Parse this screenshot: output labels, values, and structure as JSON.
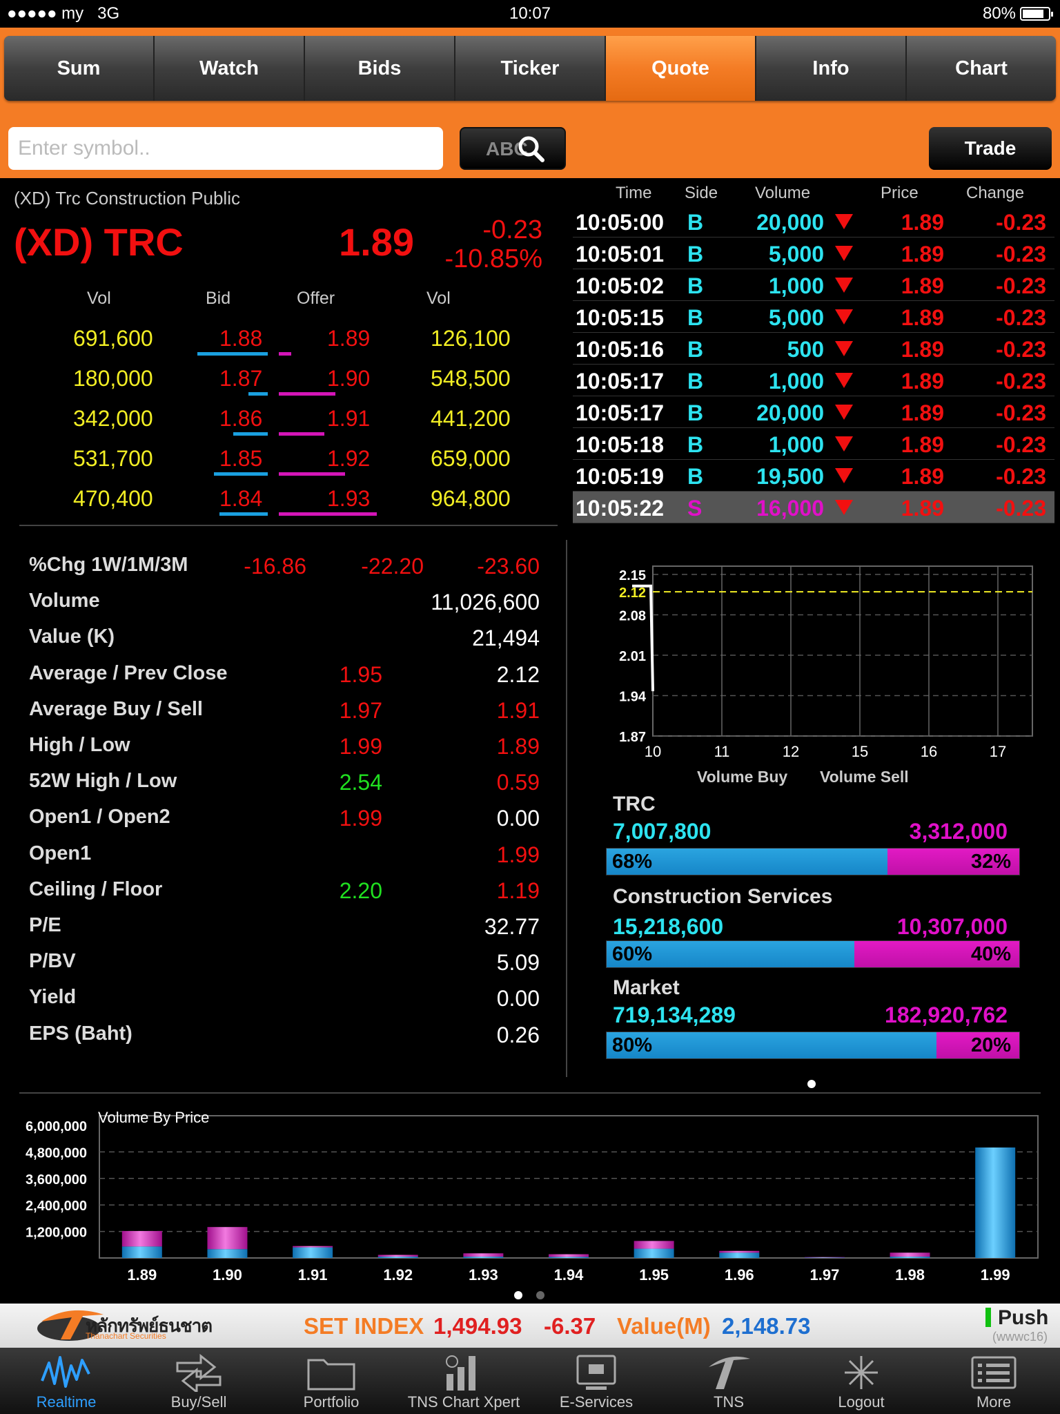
{
  "status": {
    "carrier": "●●●●● my",
    "network": "3G",
    "time": "10:07",
    "battery": "80%"
  },
  "tabs": [
    "Sum",
    "Watch",
    "Bids",
    "Ticker",
    "Quote",
    "Info",
    "Chart"
  ],
  "active_tab": "Quote",
  "search": {
    "placeholder": "Enter symbol..",
    "abc_label": "ABC"
  },
  "trade_label": "Trade",
  "stock": {
    "company": "(XD) Trc Construction Public",
    "symbol": "(XD) TRC",
    "last": "1.89",
    "change": "-0.23",
    "pct": "-10.85%"
  },
  "bidoffer": {
    "headers": [
      "Vol",
      "Bid",
      "Offer",
      "Vol"
    ],
    "rows": [
      {
        "bid_vol": "691,600",
        "bid": "1.88",
        "offer": "1.89",
        "offer_vol": "126,100"
      },
      {
        "bid_vol": "180,000",
        "bid": "1.87",
        "offer": "1.90",
        "offer_vol": "548,500"
      },
      {
        "bid_vol": "342,000",
        "bid": "1.86",
        "offer": "1.91",
        "offer_vol": "441,200"
      },
      {
        "bid_vol": "531,700",
        "bid": "1.85",
        "offer": "1.92",
        "offer_vol": "659,000"
      },
      {
        "bid_vol": "470,400",
        "bid": "1.84",
        "offer": "1.93",
        "offer_vol": "964,800"
      }
    ]
  },
  "ticker": {
    "headers": [
      "Time",
      "Side",
      "Volume",
      "Price",
      "Change"
    ],
    "rows": [
      {
        "time": "10:05:00",
        "side": "B",
        "volume": "20,000",
        "price": "1.89",
        "change": "-0.23"
      },
      {
        "time": "10:05:01",
        "side": "B",
        "volume": "5,000",
        "price": "1.89",
        "change": "-0.23"
      },
      {
        "time": "10:05:02",
        "side": "B",
        "volume": "1,000",
        "price": "1.89",
        "change": "-0.23"
      },
      {
        "time": "10:05:15",
        "side": "B",
        "volume": "5,000",
        "price": "1.89",
        "change": "-0.23"
      },
      {
        "time": "10:05:16",
        "side": "B",
        "volume": "500",
        "price": "1.89",
        "change": "-0.23"
      },
      {
        "time": "10:05:17",
        "side": "B",
        "volume": "1,000",
        "price": "1.89",
        "change": "-0.23"
      },
      {
        "time": "10:05:17",
        "side": "B",
        "volume": "20,000",
        "price": "1.89",
        "change": "-0.23"
      },
      {
        "time": "10:05:18",
        "side": "B",
        "volume": "1,000",
        "price": "1.89",
        "change": "-0.23"
      },
      {
        "time": "10:05:19",
        "side": "B",
        "volume": "19,500",
        "price": "1.89",
        "change": "-0.23"
      },
      {
        "time": "10:05:22",
        "side": "S",
        "volume": "16,000",
        "price": "1.89",
        "change": "-0.23"
      }
    ]
  },
  "stats": [
    {
      "label": "%Chg 1W/1M/3M",
      "v1": "-16.86",
      "v2": "-22.20",
      "v3": "-23.60"
    },
    {
      "label": "Volume",
      "right": "11,026,600"
    },
    {
      "label": "Value (K)",
      "right": "21,494"
    },
    {
      "label": "Average / Prev Close",
      "mid": "1.95",
      "right": "2.12"
    },
    {
      "label": "Average Buy / Sell",
      "mid": "1.97",
      "right": "1.91"
    },
    {
      "label": "High / Low",
      "mid": "1.99",
      "right": "1.89"
    },
    {
      "label": "52W High / Low",
      "mid": "2.54",
      "right": "0.59"
    },
    {
      "label": "Open1 / Open2",
      "mid": "1.99",
      "right": "0.00"
    },
    {
      "label": "Open1",
      "right": "1.99"
    },
    {
      "label": "Ceiling / Floor",
      "mid": "2.20",
      "right": "1.19"
    },
    {
      "label": "P/E",
      "right": "32.77"
    },
    {
      "label": "P/BV",
      "right": "5.09"
    },
    {
      "label": "Yield",
      "right": "0.00"
    },
    {
      "label": "EPS (Baht)",
      "right": "0.26"
    }
  ],
  "colors": {
    "red": "#f21010",
    "green": "#20e020",
    "white": "#ffffff",
    "yellow": "#f2ee24",
    "cyan": "#2de3f0",
    "magenta": "#e010c8",
    "orange": "#f47c25",
    "blue": "#2e9fff"
  },
  "chart_data": [
    {
      "type": "line",
      "x_ticks": [
        "10",
        "11",
        "12",
        "15",
        "16",
        "17"
      ],
      "y_ticks": [
        2.15,
        2.08,
        2.01,
        1.94,
        1.87
      ],
      "ylim": [
        1.87,
        2.15
      ],
      "prev_close_line": 2.12,
      "series": [
        {
          "x": [
            9.7,
            9.97,
            10.0,
            10.02
          ],
          "y": [
            2.13,
            2.13,
            1.95,
            1.95
          ]
        }
      ]
    },
    {
      "type": "bar",
      "title": "Volume By Price",
      "categories": [
        "1.89",
        "1.90",
        "1.91",
        "1.92",
        "1.93",
        "1.94",
        "1.95",
        "1.96",
        "1.97",
        "1.98",
        "1.99"
      ],
      "y_ticks": [
        "6,000,000",
        "4,800,000",
        "3,600,000",
        "2,400,000",
        "1,200,000"
      ],
      "ylim": [
        0,
        6000000
      ],
      "series": [
        {
          "values": [
            520000,
            400000,
            480000,
            60000,
            60000,
            50000,
            420000,
            240000,
            20000,
            60000,
            5000000
          ]
        },
        {
          "values": [
            700000,
            1000000,
            60000,
            80000,
            150000,
            120000,
            350000,
            80000,
            20000,
            180000,
            0
          ]
        }
      ]
    }
  ],
  "volume_labels": {
    "buy": "Volume Buy",
    "sell": "Volume Sell"
  },
  "vol_buysell": [
    {
      "label": "TRC",
      "buy": "7,007,800",
      "sell": "3,312,000",
      "buy_pct": 68,
      "buy_label": "68%",
      "sell_label": "32%"
    },
    {
      "label": "Construction Services",
      "buy": "15,218,600",
      "sell": "10,307,000",
      "buy_pct": 60,
      "buy_label": "60%",
      "sell_label": "40%"
    },
    {
      "label": "Market",
      "buy": "719,134,289",
      "sell": "182,920,762",
      "buy_pct": 80,
      "buy_label": "80%",
      "sell_label": "20%"
    }
  ],
  "index_bar": {
    "brand": "หลักทรัพย์ธนชาต",
    "brand_sub": "Thanachart Securities",
    "index_label": "SET INDEX",
    "index_value": "1,494.93",
    "index_change": "-6.37",
    "value_label": "Value(M)",
    "value": "2,148.73",
    "push_label": "Push",
    "push_sub": "(wwwc16)"
  },
  "tabbar": [
    {
      "label": "Realtime",
      "icon": "realtime-icon"
    },
    {
      "label": "Buy/Sell",
      "icon": "buysell-icon"
    },
    {
      "label": "Portfolio",
      "icon": "portfolio-icon"
    },
    {
      "label": "TNS Chart Xpert",
      "icon": "chart-xpert-icon"
    },
    {
      "label": "E-Services",
      "icon": "eservices-icon"
    },
    {
      "label": "TNS",
      "icon": "tns-icon"
    },
    {
      "label": "Logout",
      "icon": "logout-icon"
    },
    {
      "label": "More",
      "icon": "more-icon"
    }
  ],
  "active_tabbar": "Realtime"
}
